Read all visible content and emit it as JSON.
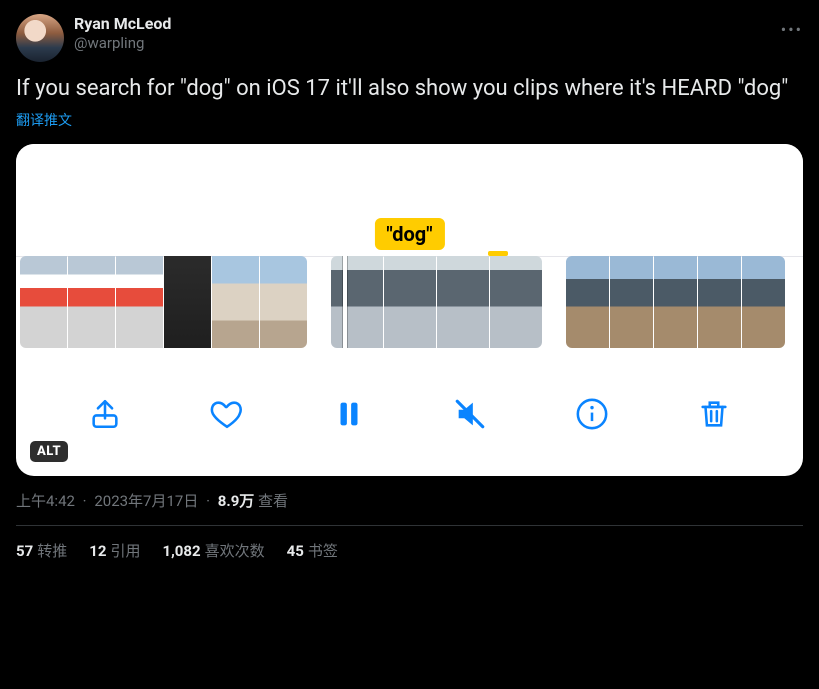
{
  "tweet": {
    "author": {
      "display_name": "Ryan McLeod",
      "handle": "@warpling"
    },
    "text": "If you search for \"dog\" on iOS 17 it'll also show you clips where it's HEARD \"dog\"",
    "translate_label": "翻译推文",
    "media": {
      "chip_label": "\"dog\"",
      "alt_badge": "ALT",
      "controls": {
        "share": "share",
        "like": "like",
        "pause": "pause",
        "mute": "mute",
        "info": "info",
        "trash": "trash"
      }
    },
    "meta": {
      "time": "上午4:42",
      "date": "2023年7月17日",
      "views_number": "8.9万",
      "views_label": "查看"
    },
    "stats": {
      "retweets_num": "57",
      "retweets_label": "转推",
      "quotes_num": "12",
      "quotes_label": "引用",
      "likes_num": "1,082",
      "likes_label": "喜欢次数",
      "bookmarks_num": "45",
      "bookmarks_label": "书签"
    }
  }
}
